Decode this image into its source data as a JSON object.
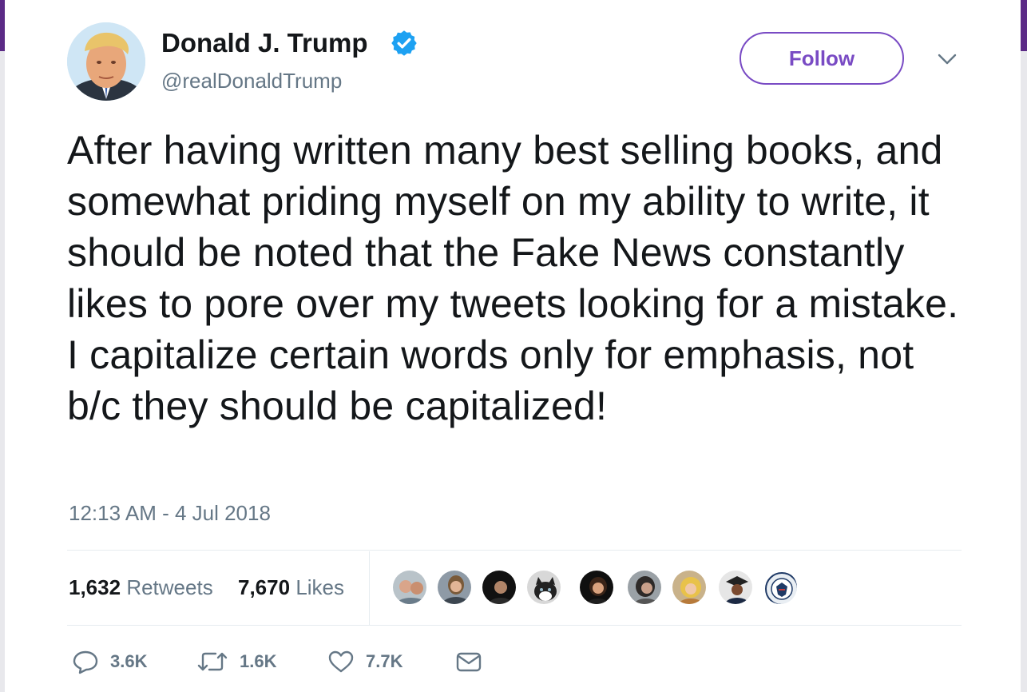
{
  "tweet": {
    "author": {
      "name": "Donald J. Trump",
      "handle": "@realDonaldTrump",
      "verified": true,
      "avatar_icon": "avatar-photo"
    },
    "follow_label": "Follow",
    "text": "After having written many best selling books, and somewhat priding myself on my ability to write, it should be noted that the Fake News constantly likes to pore over my tweets looking for a mistake. I capitalize certain words only for emphasis, not b/c they should be capitalized!",
    "timestamp": "12:13 AM - 4 Jul 2018",
    "stats": {
      "retweets_count": "1,632",
      "retweets_label": "Retweets",
      "likes_count": "7,670",
      "likes_label": "Likes"
    },
    "actions": {
      "replies": "3.6K",
      "retweets": "1.6K",
      "likes": "7.7K"
    }
  },
  "colors": {
    "accent": "#794bc4",
    "verified": "#1da1f2",
    "text_primary": "#14171a",
    "text_secondary": "#657786",
    "window_accent": "#5b2a86"
  }
}
